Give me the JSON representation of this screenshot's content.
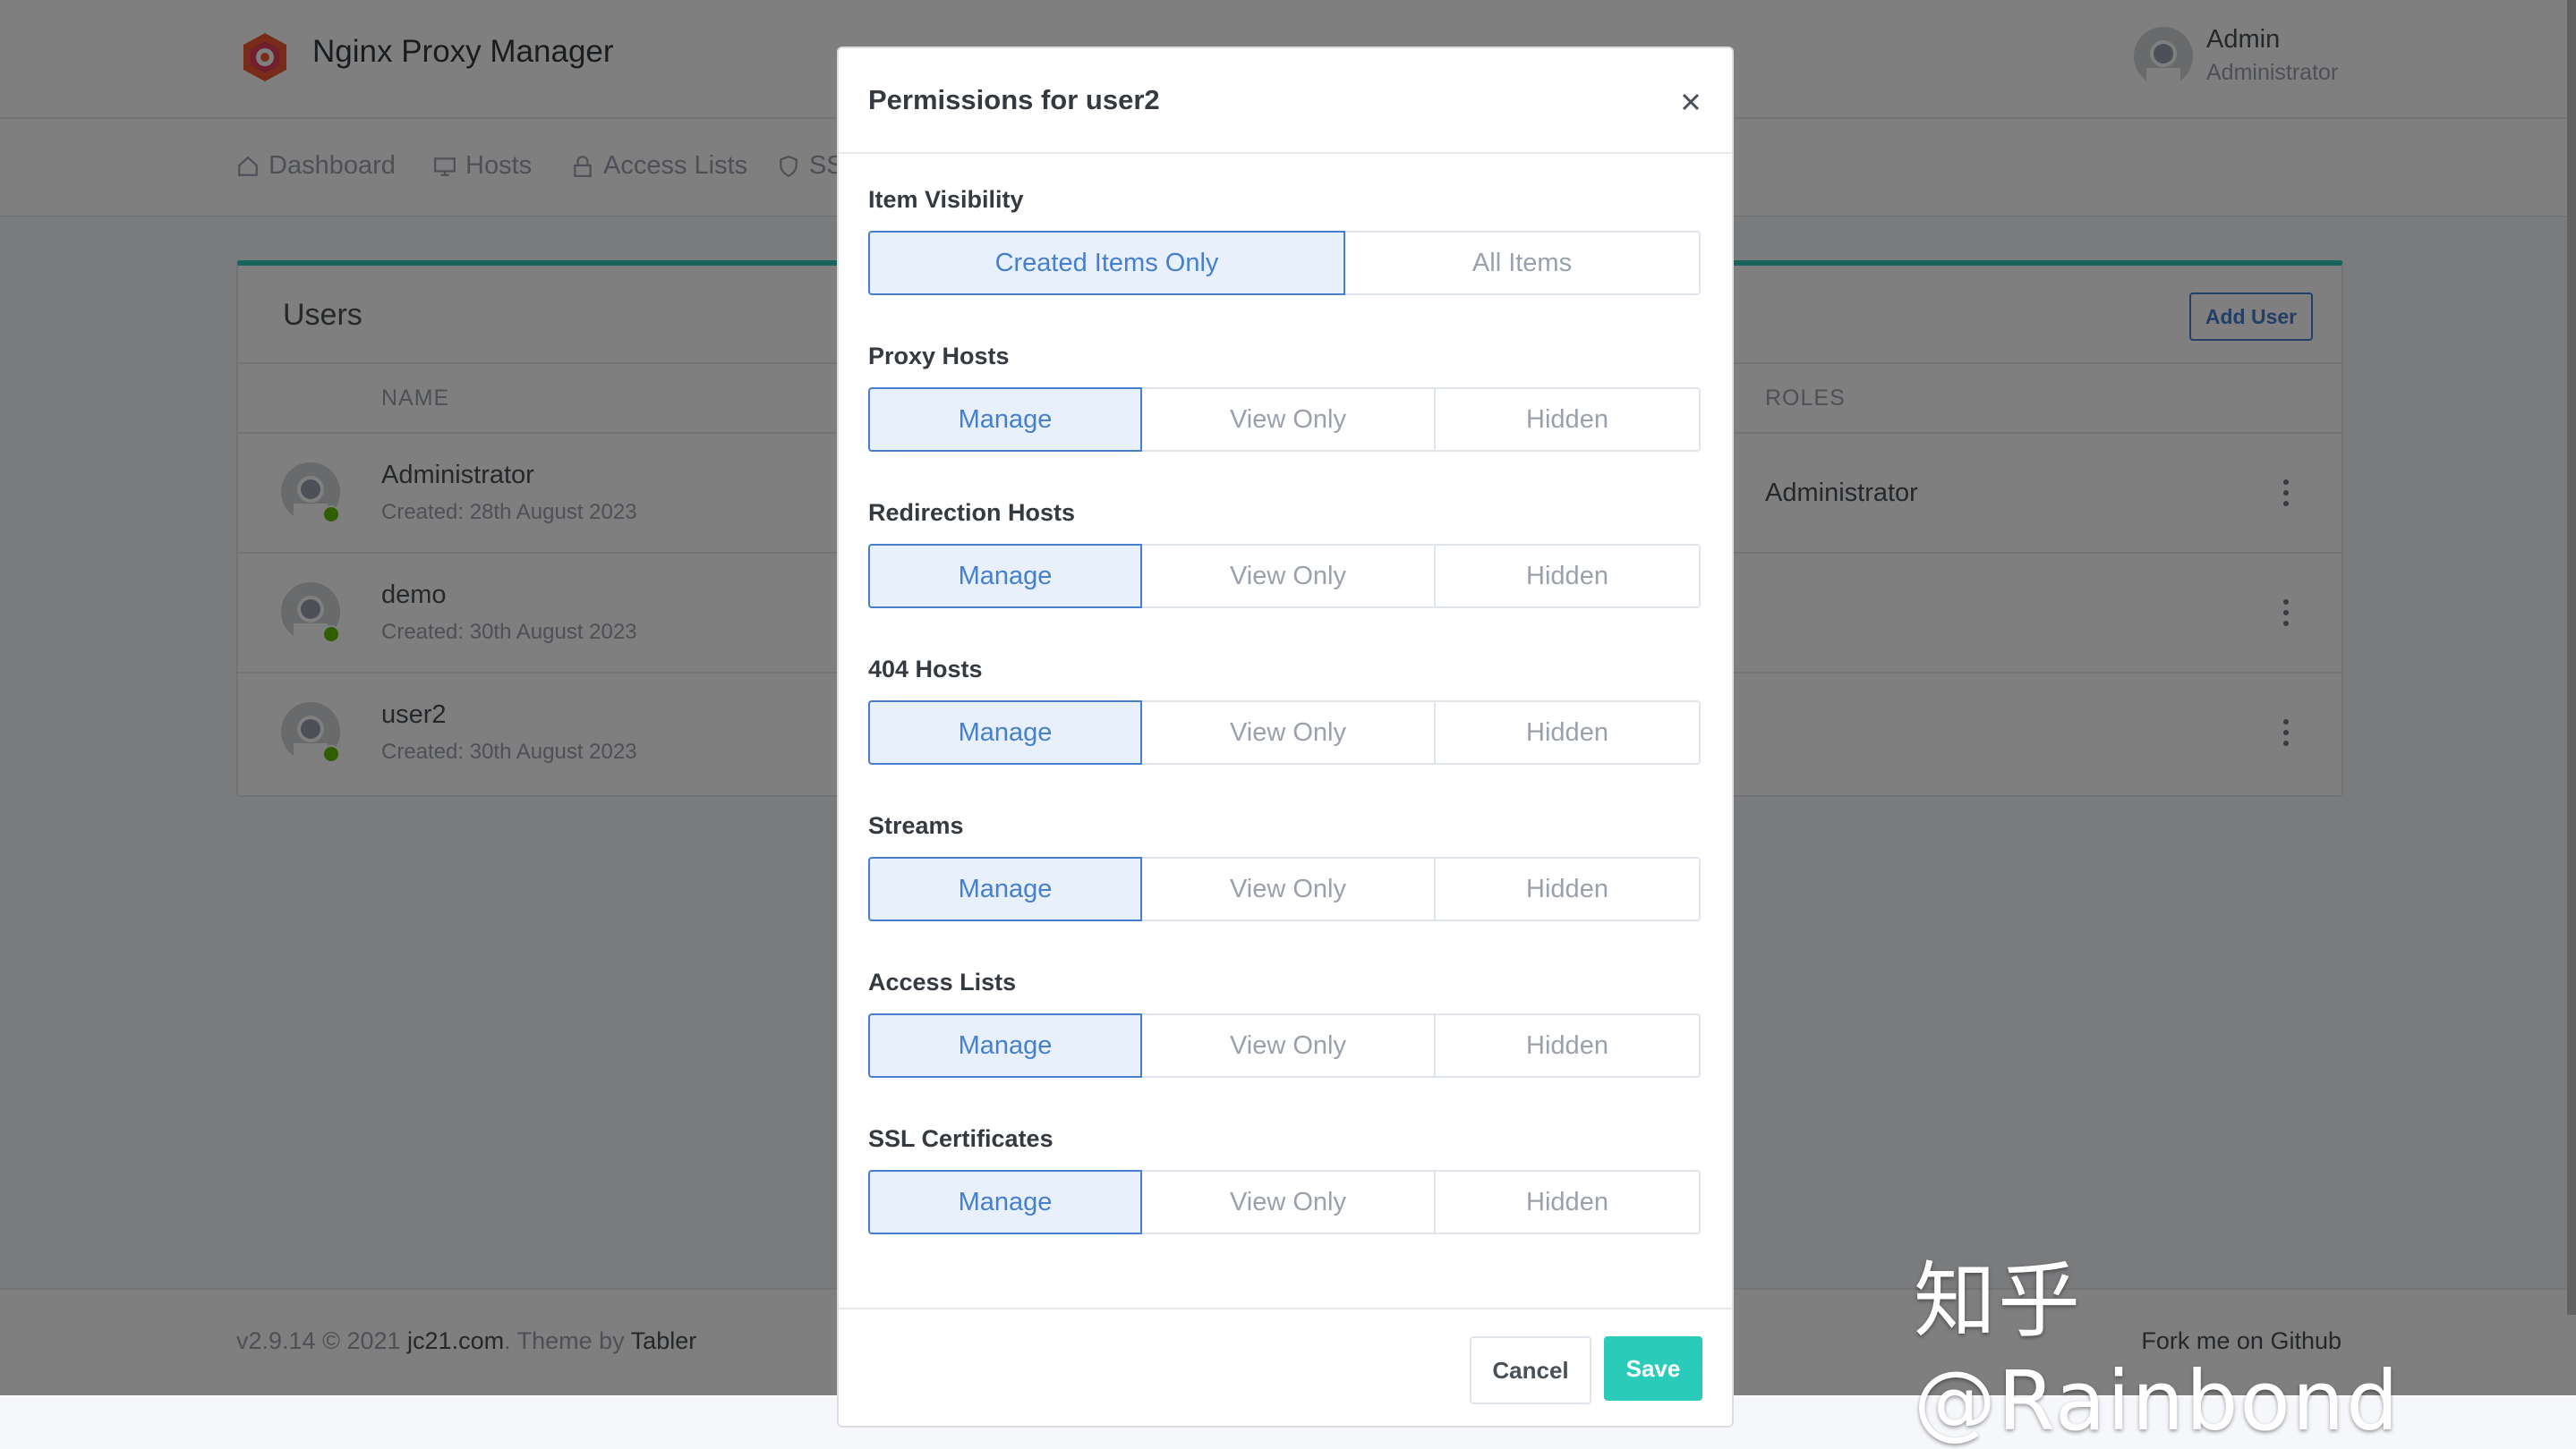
{
  "app": {
    "title": "Nginx Proxy Manager"
  },
  "user": {
    "name": "Admin",
    "role": "Administrator"
  },
  "nav": {
    "items": [
      {
        "label": "Dashboard",
        "icon": "home-icon"
      },
      {
        "label": "Hosts",
        "icon": "monitor-icon"
      },
      {
        "label": "Access Lists",
        "icon": "lock-icon"
      },
      {
        "label": "SS",
        "icon": "shield-icon"
      }
    ]
  },
  "users_card": {
    "title": "Users",
    "add_label": "Add User",
    "columns": {
      "name": "NAME",
      "roles": "ROLES"
    },
    "rows": [
      {
        "name": "Administrator",
        "created": "Created: 28th August 2023",
        "role": "Administrator"
      },
      {
        "name": "demo",
        "created": "Created: 30th August 2023",
        "role": ""
      },
      {
        "name": "user2",
        "created": "Created: 30th August 2023",
        "role": ""
      }
    ]
  },
  "footer": {
    "version": "v2.9.14 © 2021 ",
    "site": "jc21.com",
    "theme_by": ". Theme by ",
    "theme": "Tabler",
    "github": "Fork me on Github"
  },
  "modal": {
    "title": "Permissions for user2",
    "visibility": {
      "label": "Item Visibility",
      "options": [
        "Created Items Only",
        "All Items"
      ],
      "selected": "Created Items Only"
    },
    "sections": [
      {
        "label": "Proxy Hosts",
        "options": [
          "Manage",
          "View Only",
          "Hidden"
        ],
        "selected": "Manage"
      },
      {
        "label": "Redirection Hosts",
        "options": [
          "Manage",
          "View Only",
          "Hidden"
        ],
        "selected": "Manage"
      },
      {
        "label": "404 Hosts",
        "options": [
          "Manage",
          "View Only",
          "Hidden"
        ],
        "selected": "Manage"
      },
      {
        "label": "Streams",
        "options": [
          "Manage",
          "View Only",
          "Hidden"
        ],
        "selected": "Manage"
      },
      {
        "label": "Access Lists",
        "options": [
          "Manage",
          "View Only",
          "Hidden"
        ],
        "selected": "Manage"
      },
      {
        "label": "SSL Certificates",
        "options": [
          "Manage",
          "View Only",
          "Hidden"
        ],
        "selected": "Manage"
      }
    ],
    "cancel_label": "Cancel",
    "save_label": "Save"
  },
  "watermark": "知乎 @Rainbond",
  "colors": {
    "accent": "#467fcf",
    "teal": "#2bcbba",
    "online": "#5eba00"
  }
}
